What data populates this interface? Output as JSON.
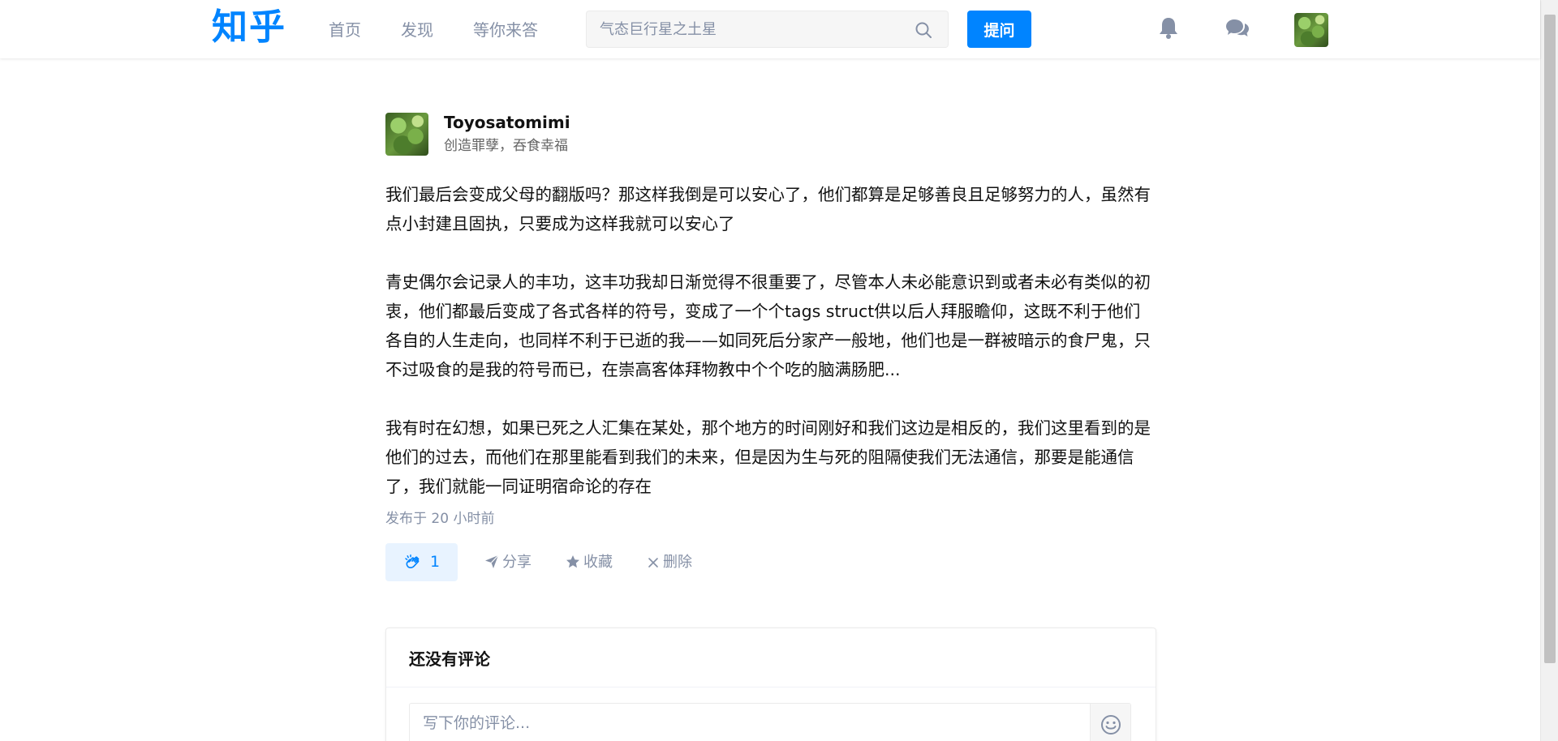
{
  "header": {
    "logo": "知乎",
    "nav": [
      {
        "label": "首页"
      },
      {
        "label": "发现"
      },
      {
        "label": "等你来答"
      }
    ],
    "search": {
      "placeholder": "气态巨行星之土星"
    },
    "ask_label": "提问",
    "icons": [
      "bell-icon",
      "chat-bubbles-icon",
      "user-avatar"
    ]
  },
  "post": {
    "author": {
      "name": "Toyosatomimi",
      "bio": "创造罪孽，吞食幸福"
    },
    "paragraphs": [
      "我们最后会变成父母的翻版吗？那这样我倒是可以安心了，他们都算是足够善良且足够努力的人，虽然有点小封建且固执，只要成为这样我就可以安心了",
      "青史偶尔会记录人的丰功，这丰功我却日渐觉得不很重要了，尽管本人未必能意识到或者未必有类似的初衷，他们都最后变成了各式各样的符号，变成了一个个tags struct供以后人拜服瞻仰，这既不利于他们各自的人生走向，也同样不利于已逝的我——如同死后分家产一般地，他们也是一群被暗示的食尸鬼，只不过吸食的是我的符号而已，在崇高客体拜物教中个个吃的脑满肠肥...",
      "我有时在幻想，如果已死之人汇集在某处，那个地方的时间刚好和我们这边是相反的，我们这里看到的是他们的过去，而他们在那里能看到我们的未来，但是因为生与死的阻隔使我们无法通信，那要是能通信了，我们就能一同证明宿命论的存在"
    ],
    "time": "发布于 20 小时前",
    "actions": {
      "clap_count": "1",
      "share": "分享",
      "collect": "收藏",
      "delete": "删除"
    }
  },
  "comments": {
    "title": "还没有评论",
    "placeholder": "写下你的评论..."
  },
  "colors": {
    "brand": "#0084ff",
    "muted": "#8590a6",
    "clap_bg": "#e8f3ff"
  }
}
